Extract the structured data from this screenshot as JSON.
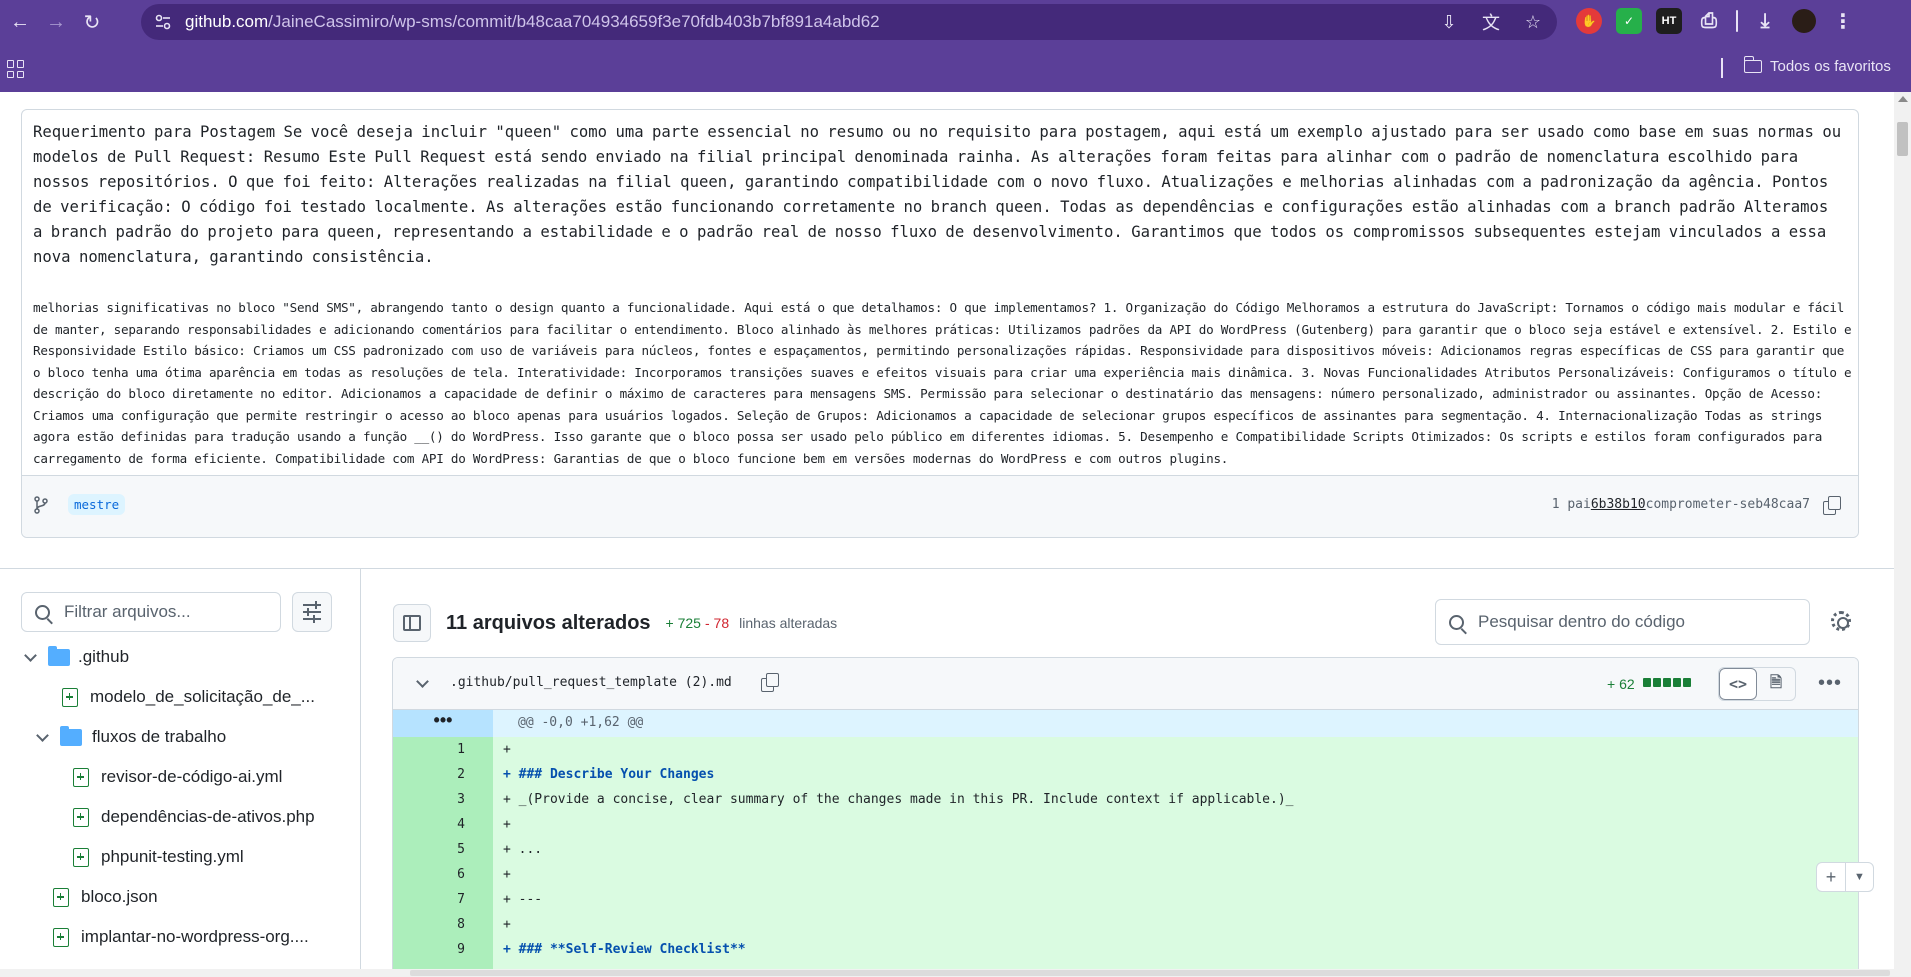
{
  "browser": {
    "url_host": "github.com",
    "url_path": "/JaineCassimiro/wp-sms/commit/b48caa704934659f3e70fdb403b7bf891a4abd62",
    "bookmarks_folder": "Todos os favoritos",
    "extensions": [
      "HT"
    ]
  },
  "commit": {
    "title": "Requerimento para Postagem Se você deseja incluir \"queen\" como uma parte essencial no resumo ou no requisito para postagem, aqui está um exemplo ajustado para ser usado como base em suas normas ou modelos de Pull Request: Resumo Este Pull Request está sendo enviado na filial principal denominada rainha. As alterações foram feitas para alinhar com o padrão de nomenclatura escolhido para nossos repositórios. O que foi feito: Alterações realizadas na filial queen, garantindo compatibilidade com o novo fluxo. Atualizações e melhorias alinhadas com a padronização da agência. Pontos de verificação: O código foi testado localmente. As alterações estão funcionando corretamente no branch queen. Todas as dependências e configurações estão alinhadas com a branch padrão Alteramos a branch padrão do projeto para queen, representando a estabilidade e o padrão real de nosso fluxo de desenvolvimento. Garantimos que todos os compromissos subsequentes estejam vinculados a essa nova nomenclatura, garantindo consistência.",
    "description": "melhorias significativas no bloco \"Send SMS\", abrangendo tanto o design quanto a funcionalidade. Aqui está o que detalhamos: O que implementamos? 1. Organização do Código Melhoramos a estrutura do JavaScript: Tornamos o código mais modular e fácil de manter, separando responsabilidades e adicionando comentários para facilitar o entendimento. Bloco alinhado às melhores práticas: Utilizamos padrões da API do WordPress (Gutenberg) para garantir que o bloco seja estável e extensível. 2. Estilo e Responsividade Estilo básico: Criamos um CSS padronizado com uso de variáveis para núcleos, fontes e espaçamentos, permitindo personalizações rápidas. Responsividade para dispositivos móveis: Adicionamos regras específicas de CSS para garantir que o bloco tenha uma ótima aparência em todas as resoluções de tela. Interatividade: Incorporamos transições suaves e efeitos visuais para criar uma experiência mais dinâmica. 3. Novas Funcionalidades Atributos Personalizáveis: Configuramos o título e descrição do bloco diretamente no editor. Adicionamos a capacidade de definir o máximo de caracteres para mensagens SMS. Permissão para selecionar o destinatário das mensagens: número personalizado, administrador ou assinantes. Opção de Acesso: Criamos uma configuração que permite restringir o acesso ao bloco apenas para usuários logados. Seleção de Grupos: Adicionamos a capacidade de selecionar grupos específicos de assinantes para segmentação. 4. Internacionalização Todas as strings agora estão definidas para tradução usando a função __() do WordPress. Isso garante que o bloco possa ser usado pelo público em diferentes idiomas. 5. Desempenho e Compatibilidade Scripts Otimizados: Os scripts e estilos foram configurados para carregamento de forma eficiente. Compatibilidade com API do WordPress: Garantias de que o bloco funcione bem em versões modernas do WordPress e com outros plugins.",
    "branch": "mestre",
    "parents_prefix": "1 pai",
    "parent_sha": "6b38b10",
    "commit_label": "comprometer-se",
    "commit_sha": "b48caa7"
  },
  "sidebar": {
    "filter_placeholder": "Filtrar arquivos...",
    "tree": [
      {
        "label": ".github",
        "type": "folder"
      },
      {
        "label": "modelo_de_solicitação_de_...",
        "type": "file"
      },
      {
        "label": "fluxos de trabalho",
        "type": "folder"
      },
      {
        "label": "revisor-de-código-ai.yml",
        "type": "file"
      },
      {
        "label": "dependências-de-ativos.php",
        "type": "file"
      },
      {
        "label": "phpunit-testing.yml",
        "type": "file"
      },
      {
        "label": "bloco.json",
        "type": "file"
      },
      {
        "label": "implantar-no-wordpress-org....",
        "type": "file"
      }
    ]
  },
  "diff": {
    "files_changed": "11 arquivos alterados",
    "additions": "+ 725",
    "deletions": "- 78",
    "lines_label": "linhas alteradas",
    "code_search_placeholder": "Pesquisar dentro do código",
    "file": {
      "name": ".github/pull_request_template (2).md",
      "count": "+ 62",
      "hunk_gutter": "•••",
      "hunk": "@@ -0,0 +1,62 @@",
      "lines": [
        {
          "num": "1",
          "text": "+"
        },
        {
          "num": "2",
          "text": "+ ### Describe Your Changes"
        },
        {
          "num": "3",
          "text": "+ _(Provide a concise, clear summary of the changes made in this PR. Include context if applicable.)_"
        },
        {
          "num": "4",
          "text": "+"
        },
        {
          "num": "5",
          "text": "+ ..."
        },
        {
          "num": "6",
          "text": "+"
        },
        {
          "num": "7",
          "text": "+ ---"
        },
        {
          "num": "8",
          "text": "+"
        },
        {
          "num": "9",
          "text": "+ ### **Self-Review Checklist**"
        }
      ]
    }
  },
  "colors": {
    "browser_chrome": "#5b3f98",
    "addition_bg": "#dafbe1",
    "addition_gutter": "#aceebb",
    "hunk_bg": "#ddf4ff",
    "link_blue": "#0969da"
  }
}
